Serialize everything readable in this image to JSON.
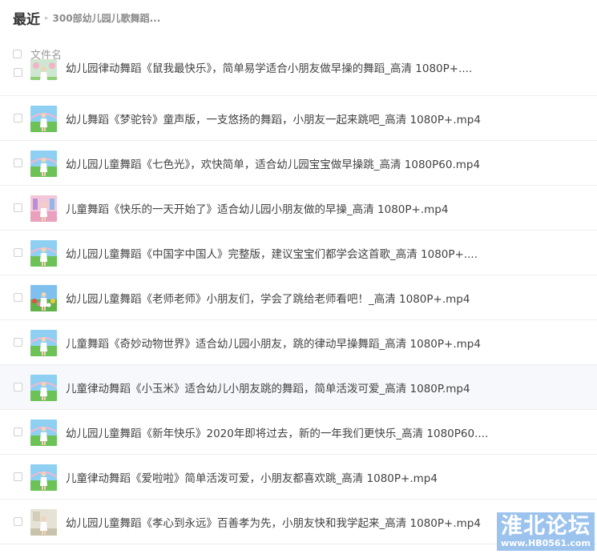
{
  "header": {
    "title": "最近",
    "separator": "▸",
    "breadcrumb": "300部幼儿园儿歌舞蹈..."
  },
  "list_header": {
    "column_label": "文件名"
  },
  "files": [
    {
      "name": "幼儿园律动舞蹈《鼠我最快乐》，简单易学适合小朋友做早操的舞蹈_高清 1080P+....",
      "thumb": "sky"
    },
    {
      "name": "幼儿舞蹈《梦驼铃》童声版，一支悠扬的舞蹈，小朋友一起来跳吧_高清 1080P+.mp4",
      "thumb": "grass"
    },
    {
      "name": "幼儿园儿童舞蹈《七色光》，欢快简单，适合幼儿园宝宝做早操跳_高清 1080P60.mp4",
      "thumb": "grass"
    },
    {
      "name": "儿童舞蹈《快乐的一天开始了》适合幼儿园小朋友做的早操_高清 1080P+.mp4",
      "thumb": "pink"
    },
    {
      "name": "幼儿园儿童舞蹈《中国字中国人》完整版，建议宝宝们都学会这首歌_高清 1080P+....",
      "thumb": "grass"
    },
    {
      "name": "幼儿园儿童舞蹈《老师老师》小朋友们，学会了跳给老师看吧！_高清 1080P+.mp4",
      "thumb": "flowers"
    },
    {
      "name": "儿童舞蹈《奇妙动物世界》适合幼儿园小朋友，跳的律动早操舞蹈_高清 1080P+.mp4",
      "thumb": "grass"
    },
    {
      "name": "儿童律动舞蹈《小玉米》适合幼儿小朋友跳的舞蹈，简单活泼可爱_高清 1080P.mp4",
      "thumb": "grass",
      "hover": true
    },
    {
      "name": "幼儿园儿童舞蹈《新年快乐》2020年即将过去，新的一年我们更快乐_高清 1080P60....",
      "thumb": "grass"
    },
    {
      "name": "儿童律动舞蹈《爱啦啦》简单活泼可爱，小朋友都喜欢跳_高清 1080P+.mp4",
      "thumb": "grass"
    },
    {
      "name": "幼儿园儿童舞蹈《孝心到永远》百善孝为先，小朋友快和我学起来_高清 1080P+.mp4",
      "thumb": "room"
    }
  ],
  "watermark": {
    "main": "淮北论坛",
    "sub": "www.HB0561.com"
  },
  "colors": {
    "text": "#424242",
    "muted": "#9a9a9a",
    "hover_row": "#f7f8fb",
    "divider": "#eeeeee"
  }
}
